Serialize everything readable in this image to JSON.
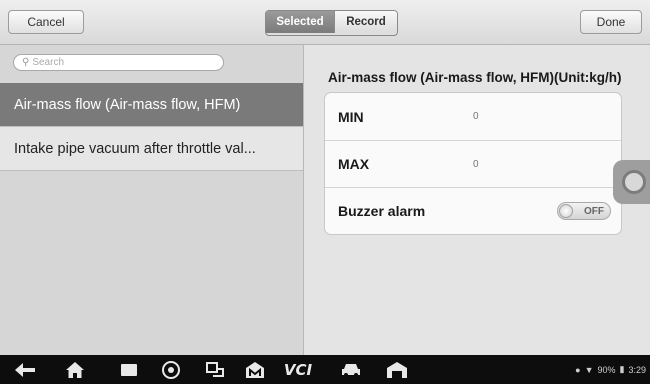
{
  "toolbar": {
    "cancel_label": "Cancel",
    "selected_label": "Selected",
    "record_label": "Record",
    "done_label": "Done"
  },
  "search": {
    "placeholder": "Search"
  },
  "list": {
    "items": [
      {
        "label": "Air-mass flow (Air-mass flow, HFM)",
        "active": true
      },
      {
        "label": "Intake pipe vacuum after throttle val...",
        "active": false
      }
    ]
  },
  "detail": {
    "title": "Air-mass flow (Air-mass flow, HFM)(Unit:kg/h)",
    "min_label": "MIN",
    "min_value": "0",
    "max_label": "MAX",
    "max_value": "0",
    "buzzer_label": "Buzzer alarm",
    "buzzer_state": "OFF"
  },
  "navbar": {
    "vci_label": "VCI",
    "status": {
      "battery": "90%",
      "time": "3:29"
    }
  },
  "colors": {
    "active_item_bg": "#7a7a7a",
    "navbar_bg": "#0d0d0d",
    "segment_selected_bg": "#888888"
  }
}
